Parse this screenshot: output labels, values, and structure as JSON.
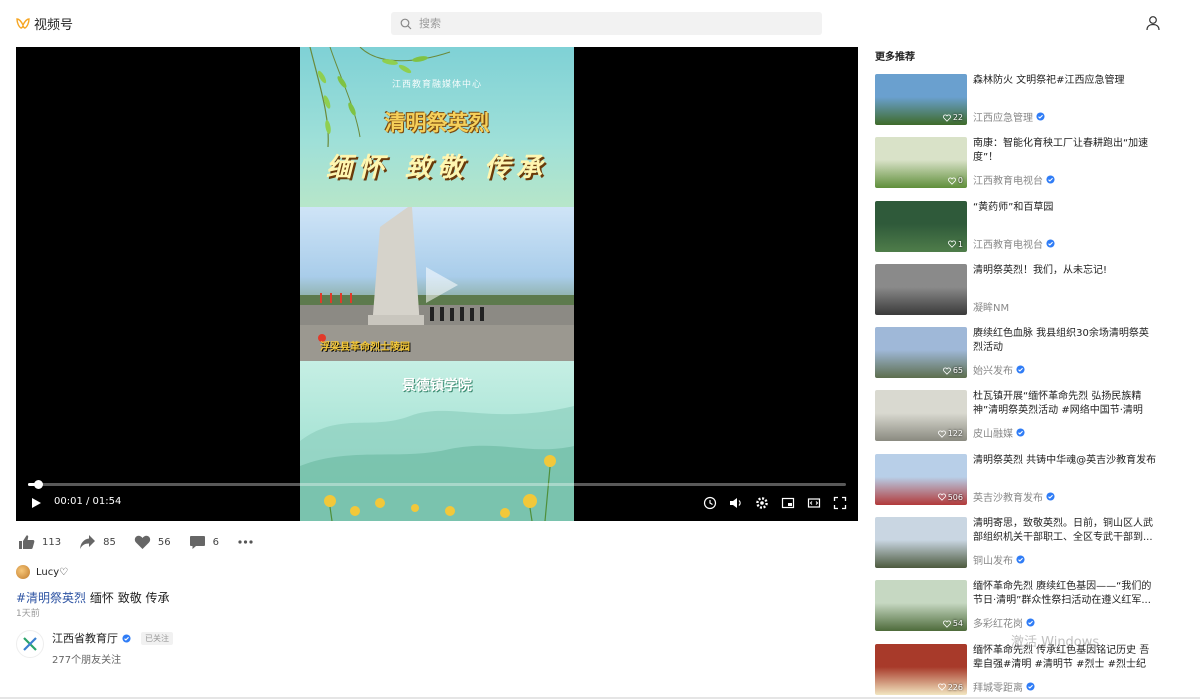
{
  "header": {
    "app_name": "视频号",
    "search_placeholder": "搜索"
  },
  "video": {
    "overlay_header": "江西教育融媒体中心",
    "title_line1": "清明祭英烈",
    "title_line2": "缅怀 致敬 传承",
    "location_label": "浮梁县革命烈士陵园",
    "school_label": "景德镇学院",
    "time": "00:01 / 01:54",
    "progress": 0.012
  },
  "actions": {
    "likes": "113",
    "shares": "85",
    "favorites": "56",
    "comments": "6"
  },
  "commenter": {
    "name": "Lucy♡"
  },
  "caption": {
    "tag": "#清明祭英烈",
    "text": "缅怀 致敬 传承"
  },
  "time_ago": "1天前",
  "author": {
    "name": "江西省教育厅",
    "followed_label": "已关注",
    "followers": "277个朋友关注"
  },
  "recommendations": {
    "title": "更多推荐",
    "items": [
      {
        "title": "森林防火 文明祭祀#江西应急管理",
        "author": "江西应急管理",
        "verified": true,
        "likes": "22",
        "colors": [
          "#6aa0cf",
          "#3f6b2a"
        ]
      },
      {
        "title": "南康：智能化育秧工厂让春耕跑出“加速度”！",
        "author": "江西教育电视台",
        "verified": true,
        "likes": "0",
        "colors": [
          "#d9e2c8",
          "#5f8e3a"
        ]
      },
      {
        "title": "“黄药师”和百草园",
        "author": "江西教育电视台",
        "verified": true,
        "likes": "1",
        "colors": [
          "#2f5a3a",
          "#4f7d4a"
        ]
      },
      {
        "title": "清明祭英烈！我们，从未忘记!",
        "author": "凝眸NM",
        "verified": false,
        "likes": "",
        "colors": [
          "#8a8a8a",
          "#3a3a3a"
        ]
      },
      {
        "title": "赓续红色血脉 我县组织30余场清明祭英烈活动",
        "author": "始兴发布",
        "verified": true,
        "likes": "65",
        "colors": [
          "#9fb8d8",
          "#5d6e4e"
        ]
      },
      {
        "title": "杜瓦镇开展“缅怀革命先烈 弘扬民族精神”清明祭英烈活动 #网络中国节·清明 （来...",
        "author": "皮山融媒",
        "verified": true,
        "likes": "122",
        "colors": [
          "#d9d9d0",
          "#8a8a80"
        ]
      },
      {
        "title": "清明祭英烈 共铸中华魂@英吉沙教育发布",
        "author": "英吉沙教育发布",
        "verified": true,
        "likes": "506",
        "colors": [
          "#b8cfe8",
          "#b23a3a"
        ]
      },
      {
        "title": "清明寄思，致敬英烈。日前，铜山区人武部组织机关干部职工、全区专武干部到...",
        "author": "铜山发布",
        "verified": true,
        "likes": "",
        "colors": [
          "#c9d6e2",
          "#4d5a3e"
        ]
      },
      {
        "title": "缅怀革命先烈 赓续红色基因——“我们的节日·清明”群众性祭扫活动在遵义红军...",
        "author": "多彩红花岗",
        "verified": true,
        "likes": "54",
        "colors": [
          "#c6d8c2",
          "#4e6b3b"
        ]
      },
      {
        "title": "缅怀革命先烈 传承红色基因铭记历史 吾辈自强#清明 #清明节 #烈士 #烈士纪念...",
        "author": "拜城零距离",
        "verified": true,
        "likes": "226",
        "colors": [
          "#a83a2a",
          "#f2e6c0"
        ]
      }
    ]
  },
  "watermark": "激活 Windows"
}
